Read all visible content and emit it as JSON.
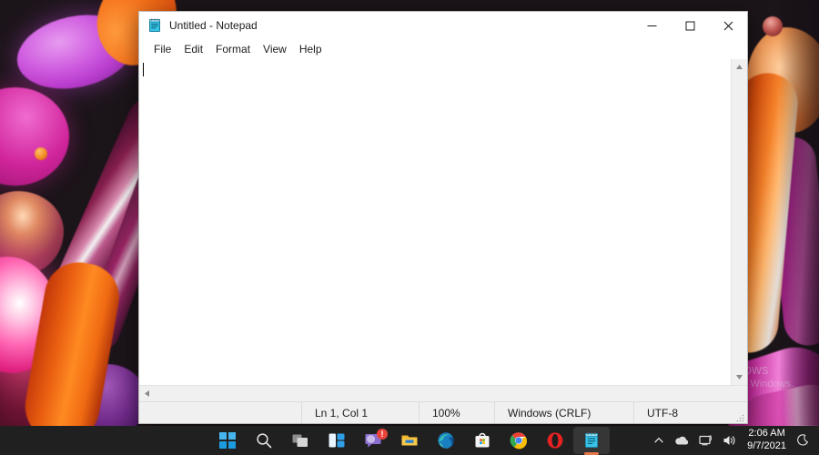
{
  "desktop": {
    "watermark_line1": "Activate Windows",
    "watermark_line2": "Go to Settings to activate Windows."
  },
  "window": {
    "title": "Untitled - Notepad",
    "icon": "notepad-icon",
    "controls": {
      "minimize": "─",
      "maximize": "□",
      "close": "✕"
    },
    "menu": [
      {
        "label": "File"
      },
      {
        "label": "Edit"
      },
      {
        "label": "Format"
      },
      {
        "label": "View"
      },
      {
        "label": "Help"
      }
    ],
    "editor": {
      "content": "",
      "caret_visible": true
    },
    "statusbar": {
      "position": "Ln 1, Col 1",
      "zoom": "100%",
      "line_ending": "Windows (CRLF)",
      "encoding": "UTF-8"
    },
    "scrollbars": {
      "vertical_up": "▲",
      "vertical_down": "▼",
      "horizontal_left": "◀"
    }
  },
  "taskbar": {
    "apps": [
      {
        "name": "start-button",
        "label": "Start"
      },
      {
        "name": "search-button",
        "label": "Search"
      },
      {
        "name": "task-view-button",
        "label": "Task View"
      },
      {
        "name": "widgets-button",
        "label": "Widgets"
      },
      {
        "name": "chat-button",
        "label": "Chat",
        "badge": "!"
      },
      {
        "name": "file-explorer-button",
        "label": "File Explorer"
      },
      {
        "name": "edge-button",
        "label": "Microsoft Edge"
      },
      {
        "name": "store-button",
        "label": "Microsoft Store"
      },
      {
        "name": "chrome-button",
        "label": "Google Chrome"
      },
      {
        "name": "opera-button",
        "label": "Opera"
      },
      {
        "name": "notepad-button",
        "label": "Notepad",
        "active": true
      }
    ],
    "tray": {
      "overflow": "show-hidden-icons",
      "onedrive": "OneDrive",
      "network": "Network",
      "volume": "Volume",
      "time": "2:06 AM",
      "date": "9/7/2021",
      "focus": "Focus assist"
    },
    "accent_active_underline": "#e8784a"
  }
}
